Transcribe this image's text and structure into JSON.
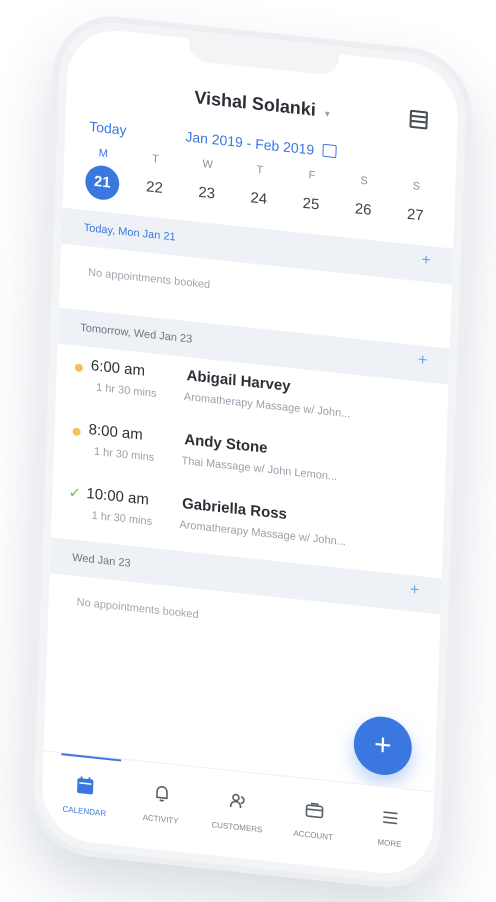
{
  "header": {
    "user_name": "Vishal Solanki",
    "caret": "▾"
  },
  "range": {
    "today_label": "Today",
    "date_range": "Jan 2019 - Feb 2019"
  },
  "week": {
    "weekdays": [
      "M",
      "T",
      "W",
      "T",
      "F",
      "S",
      "S"
    ],
    "dates": [
      "21",
      "22",
      "23",
      "24",
      "25",
      "26",
      "27"
    ],
    "selected_date": "21"
  },
  "sections": [
    {
      "title": "Today, Mon Jan 21",
      "empty_text": "No appointments booked",
      "add_icon": "+"
    },
    {
      "title": "Tomorrow, Wed Jan 23",
      "add_icon": "+",
      "appointments": [
        {
          "status_icon": "pending-dot-icon",
          "time": "6:00 am",
          "client": "Abigail Harvey",
          "duration": "1 hr 30 mins",
          "service": "Aromatherapy Massage w/ John..."
        },
        {
          "status_icon": "pending-dot-icon",
          "time": "8:00 am",
          "client": "Andy Stone",
          "duration": "1 hr 30 mins",
          "service": "Thai Massage w/ John Lemon..."
        },
        {
          "status_icon": "check-icon",
          "check_glyph": "✓",
          "time": "10:00 am",
          "client": "Gabriella Ross",
          "duration": "1 hr 30 mins",
          "service": "Aromatherapy Massage w/ John..."
        }
      ]
    },
    {
      "title": "Wed Jan 23",
      "empty_text": "No appointments booked",
      "add_icon": "+"
    }
  ],
  "fab": {
    "label": "+"
  },
  "nav": {
    "items": [
      {
        "label": "CALENDAR",
        "icon": "calendar-icon",
        "active": true
      },
      {
        "label": "ACTIVITY",
        "icon": "bell-icon",
        "active": false
      },
      {
        "label": "CUSTOMERS",
        "icon": "customers-icon",
        "active": false
      },
      {
        "label": "ACCOUNT",
        "icon": "briefcase-icon",
        "active": false
      },
      {
        "label": "MORE",
        "icon": "menu-icon",
        "active": false
      }
    ]
  },
  "colors": {
    "accent": "#3a78e0",
    "pending": "#f3c25b",
    "confirmed": "#79b94f"
  }
}
